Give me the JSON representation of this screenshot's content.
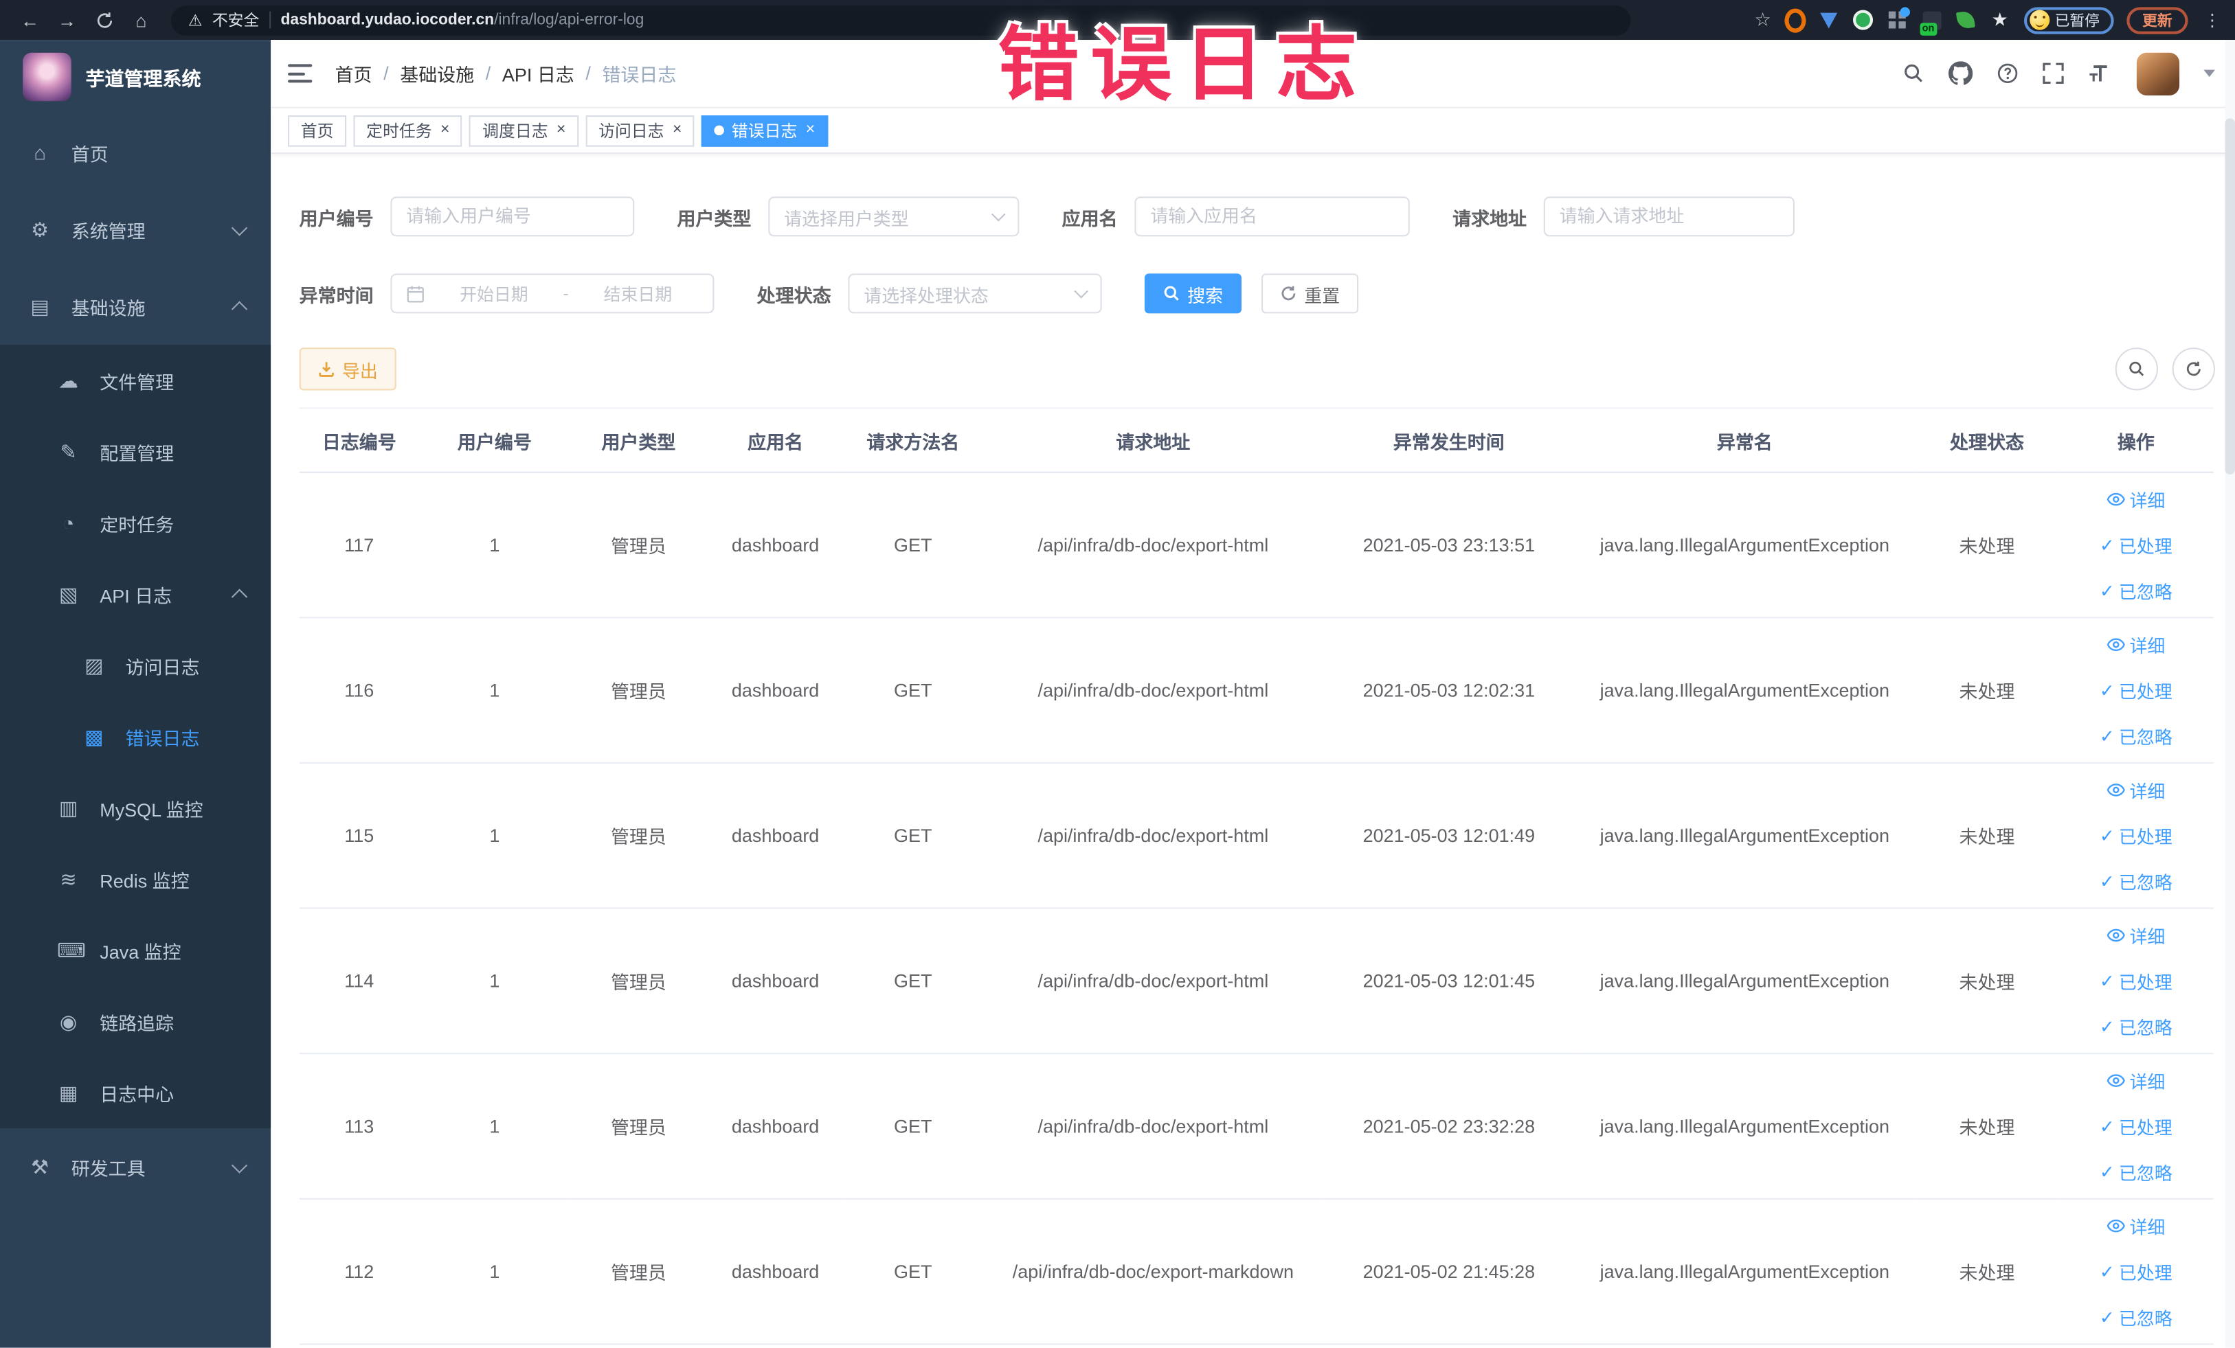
{
  "browser": {
    "security_label": "不安全",
    "url_host": "dashboard.yudao.iocoder.cn",
    "url_path": "/infra/log/api-error-log",
    "extensions_on_badge": "on",
    "paused_badge": "已暂停",
    "update_button": "更新"
  },
  "watermark": "错误日志",
  "sidebar": {
    "app_title": "芋道管理系统",
    "items": [
      {
        "key": "home",
        "label": "首页",
        "icon": "home-icon",
        "depth": 0
      },
      {
        "key": "system-management",
        "label": "系统管理",
        "icon": "gear-icon",
        "depth": 0,
        "chevron": "down"
      },
      {
        "key": "infrastructure",
        "label": "基础设施",
        "icon": "infrastructure-icon",
        "depth": 0,
        "chevron": "up"
      },
      {
        "key": "file-management",
        "label": "文件管理",
        "icon": "cloud-icon",
        "depth": 1
      },
      {
        "key": "config-management",
        "label": "配置管理",
        "icon": "edit-icon",
        "depth": 1
      },
      {
        "key": "scheduled-tasks",
        "label": "定时任务",
        "icon": "timer-icon",
        "depth": 1
      },
      {
        "key": "api-log",
        "label": "API 日志",
        "icon": "api-log-icon",
        "depth": 1,
        "chevron": "up"
      },
      {
        "key": "access-log",
        "label": "访问日志",
        "icon": "access-log-icon",
        "depth": 2
      },
      {
        "key": "error-log",
        "label": "错误日志",
        "icon": "error-log-icon",
        "depth": 2,
        "active": true
      },
      {
        "key": "mysql-monitor",
        "label": "MySQL 监控",
        "icon": "mysql-icon",
        "depth": 1
      },
      {
        "key": "redis-monitor",
        "label": "Redis 监控",
        "icon": "redis-icon",
        "depth": 1
      },
      {
        "key": "java-monitor",
        "label": "Java 监控",
        "icon": "java-icon",
        "depth": 1
      },
      {
        "key": "link-tracing",
        "label": "链路追踪",
        "icon": "trace-icon",
        "depth": 1
      },
      {
        "key": "log-center",
        "label": "日志中心",
        "icon": "log-center-icon",
        "depth": 1
      },
      {
        "key": "dev-tools",
        "label": "研发工具",
        "icon": "toolbox-icon",
        "depth": 0,
        "chevron": "down"
      }
    ]
  },
  "header": {
    "breadcrumb": [
      "首页",
      "基础设施",
      "API 日志",
      "错误日志"
    ],
    "tags": [
      {
        "label": "首页",
        "closable": false,
        "active": false
      },
      {
        "label": "定时任务",
        "closable": true,
        "active": false
      },
      {
        "label": "调度日志",
        "closable": true,
        "active": false
      },
      {
        "label": "访问日志",
        "closable": true,
        "active": false
      },
      {
        "label": "错误日志",
        "closable": true,
        "active": true
      }
    ]
  },
  "filters": {
    "user_id_label": "用户编号",
    "user_id_placeholder": "请输入用户编号",
    "user_type_label": "用户类型",
    "user_type_placeholder": "请选择用户类型",
    "app_name_label": "应用名",
    "app_name_placeholder": "请输入应用名",
    "request_url_label": "请求地址",
    "request_url_placeholder": "请输入请求地址",
    "exception_time_label": "异常时间",
    "start_date_placeholder": "开始日期",
    "range_separator": "-",
    "end_date_placeholder": "结束日期",
    "process_status_label": "处理状态",
    "process_status_placeholder": "请选择处理状态",
    "search_button": "搜索",
    "reset_button": "重置"
  },
  "toolbar": {
    "export_button": "导出"
  },
  "table": {
    "columns": [
      "日志编号",
      "用户编号",
      "用户类型",
      "应用名",
      "请求方法名",
      "请求地址",
      "异常发生时间",
      "异常名",
      "处理状态",
      "操作"
    ],
    "column_keys": [
      "log_id",
      "user_id",
      "user_type",
      "app_name",
      "method",
      "url",
      "time",
      "exception",
      "status"
    ],
    "rows": [
      {
        "log_id": "117",
        "user_id": "1",
        "user_type": "管理员",
        "app_name": "dashboard",
        "method": "GET",
        "url": "/api/infra/db-doc/export-html",
        "time": "2021-05-03 23:13:51",
        "exception": "java.lang.IllegalArgumentException",
        "status": "未处理"
      },
      {
        "log_id": "116",
        "user_id": "1",
        "user_type": "管理员",
        "app_name": "dashboard",
        "method": "GET",
        "url": "/api/infra/db-doc/export-html",
        "time": "2021-05-03 12:02:31",
        "exception": "java.lang.IllegalArgumentException",
        "status": "未处理"
      },
      {
        "log_id": "115",
        "user_id": "1",
        "user_type": "管理员",
        "app_name": "dashboard",
        "method": "GET",
        "url": "/api/infra/db-doc/export-html",
        "time": "2021-05-03 12:01:49",
        "exception": "java.lang.IllegalArgumentException",
        "status": "未处理"
      },
      {
        "log_id": "114",
        "user_id": "1",
        "user_type": "管理员",
        "app_name": "dashboard",
        "method": "GET",
        "url": "/api/infra/db-doc/export-html",
        "time": "2021-05-03 12:01:45",
        "exception": "java.lang.IllegalArgumentException",
        "status": "未处理"
      },
      {
        "log_id": "113",
        "user_id": "1",
        "user_type": "管理员",
        "app_name": "dashboard",
        "method": "GET",
        "url": "/api/infra/db-doc/export-html",
        "time": "2021-05-02 23:32:28",
        "exception": "java.lang.IllegalArgumentException",
        "status": "未处理"
      },
      {
        "log_id": "112",
        "user_id": "1",
        "user_type": "管理员",
        "app_name": "dashboard",
        "method": "GET",
        "url": "/api/infra/db-doc/export-markdown",
        "time": "2021-05-02 21:45:28",
        "exception": "java.lang.IllegalArgumentException",
        "status": "未处理"
      }
    ],
    "row_actions": {
      "detail": "详细",
      "processed": "已处理",
      "ignored": "已忽略"
    }
  },
  "colors": {
    "accent": "#409eff",
    "warning": "#e6a23c",
    "watermark_pink": "#f0315c",
    "sidebar_bg": "#2d4156",
    "submenu_bg": "#223344",
    "browser_bar_bg": "#1d232e"
  }
}
